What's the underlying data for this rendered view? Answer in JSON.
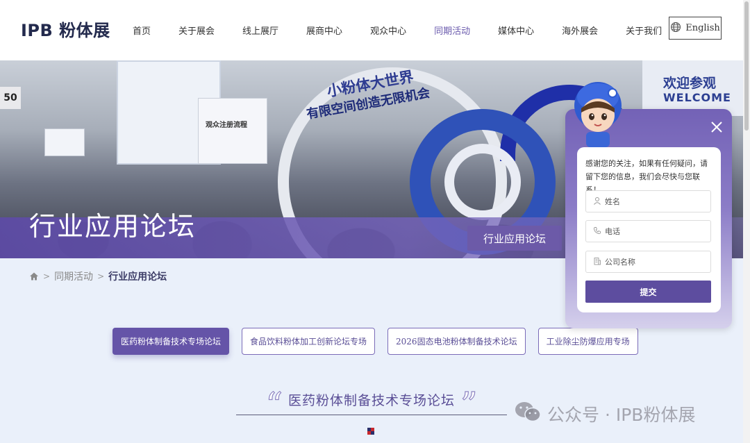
{
  "header": {
    "logo": "IPB 粉体展",
    "nav": [
      {
        "label": "首页",
        "active": false
      },
      {
        "label": "关于展会",
        "active": false
      },
      {
        "label": "线上展厅",
        "active": false
      },
      {
        "label": "展商中心",
        "active": false
      },
      {
        "label": "观众中心",
        "active": false
      },
      {
        "label": "同期活动",
        "active": true
      },
      {
        "label": "媒体中心",
        "active": false
      },
      {
        "label": "海外展会",
        "active": false
      },
      {
        "label": "关于我们",
        "active": false
      }
    ],
    "language_button": "English"
  },
  "banner": {
    "title": "行业应用论坛",
    "tag": "行业应用论坛",
    "photo_texts": {
      "slogan_line1": "小粉体大世界",
      "slogan_line2": "有限空间创造无限机会",
      "welcome_cn": "欢迎参观",
      "welcome_en": "WELCOME",
      "poster_title": "观众注册流程",
      "sign_number": "50"
    }
  },
  "breadcrumb": {
    "items": [
      "同期活动",
      "行业应用论坛"
    ],
    "separator": ">"
  },
  "tabs": [
    {
      "label": "医药粉体制备技术专场论坛",
      "active": true
    },
    {
      "label": "食品饮料粉体加工创新论坛专场",
      "active": false
    },
    {
      "label": "2026固态电池粉体制备技术论坛",
      "active": false
    },
    {
      "label": "工业除尘防爆应用专场",
      "active": false
    }
  ],
  "section": {
    "title": "医药粉体制备技术专场论坛",
    "open_quote": "“",
    "close_quote": "”"
  },
  "chat_popup": {
    "message": "感谢您的关注，如果有任何疑问，请留下您的信息，我们会尽快与您联系！",
    "fields": [
      {
        "placeholder": "姓名",
        "icon": "user-icon"
      },
      {
        "placeholder": "电话",
        "icon": "phone-icon"
      },
      {
        "placeholder": "公司名称",
        "icon": "building-icon"
      }
    ],
    "submit_label": "提交"
  },
  "watermark": {
    "text": "公众号 · IPB粉体展",
    "icon": "wechat-icon"
  },
  "colors": {
    "accent": "#6554a8",
    "nav_active": "#6a5aad",
    "logo": "#232a4d",
    "page_bg": "#eaf0fa"
  }
}
